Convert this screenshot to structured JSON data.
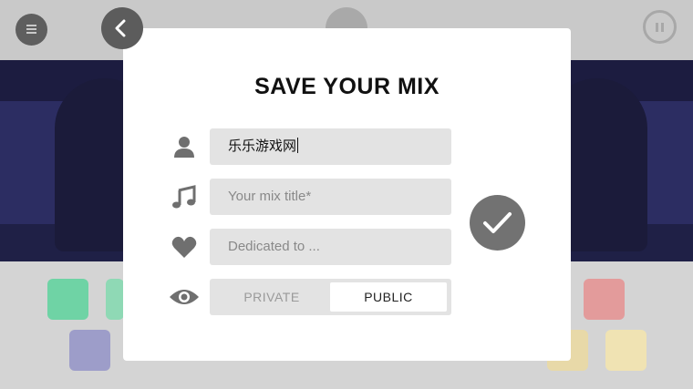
{
  "dialog": {
    "title": "SAVE YOUR MIX",
    "name_value": "乐乐游戏网",
    "mix_title_placeholder": "Your mix title*",
    "dedicated_placeholder": "Dedicated to ...",
    "visibility_options": [
      "PRIVATE",
      "PUBLIC"
    ],
    "visibility_selected": "PUBLIC"
  },
  "icons": {
    "menu": "menu-icon",
    "back": "chevron-left-icon",
    "pause": "pause-icon",
    "user": "user-icon",
    "music": "music-note-icon",
    "heart": "heart-icon",
    "eye": "eye-icon",
    "confirm": "checkmark-icon"
  },
  "colors": {
    "modal_bg": "#ffffff",
    "field_bg": "#e3e3e3",
    "icon_gray": "#6f6f6f",
    "confirm_bg": "#727272"
  }
}
